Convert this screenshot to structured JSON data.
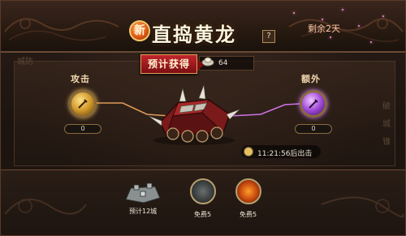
{
  "header": {
    "new_badge": "新",
    "title": "直捣黄龙",
    "help_label": "?",
    "remaining": "剩余2天"
  },
  "side": {
    "left_label": "城防",
    "right_label": "破城锥"
  },
  "estimate": {
    "label": "预计获得",
    "value": "64",
    "icon": "silver-ingot-icon"
  },
  "attack": {
    "label": "攻击",
    "count": "0",
    "icon": "sword-icon"
  },
  "extra": {
    "label": "额外",
    "count": "0",
    "icon": "sword-icon"
  },
  "timer": {
    "text": "11:21:56后出击",
    "icon": "clock-icon"
  },
  "bottom": {
    "items": [
      {
        "label": "预计12城",
        "icon": "city-wall-icon"
      },
      {
        "label": "免费5",
        "icon": "stone-seal-icon"
      },
      {
        "label": "免费5",
        "icon": "flame-cauldron-icon"
      }
    ]
  },
  "colors": {
    "accent_gold": "#f3c76a",
    "ribbon_red": "#c0262a",
    "attack_line": "#f2a860",
    "extra_line": "#e07cff"
  }
}
